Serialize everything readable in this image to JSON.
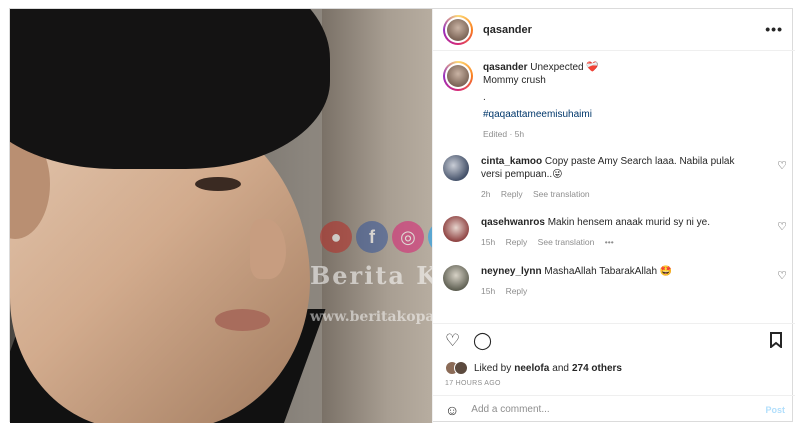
{
  "post": {
    "username": "qasander",
    "more_label": "•••"
  },
  "watermark": {
    "brand": "Berita Kopak",
    "url": "www.beritakopak.com"
  },
  "caption": {
    "username": "qasander",
    "text": "Unexpected",
    "emoji": "❤️‍🩹",
    "line2": "Mommy crush",
    "line3": ".",
    "hashtag": "#qaqaattameemisuhaimi",
    "edited": "Edited · 5h"
  },
  "comments": [
    {
      "username": "cinta_kamoo",
      "text": "Copy paste Amy Search laaa. Nabila pulak versi pempuan..😜",
      "time": "2h",
      "reply": "Reply",
      "translate": "See translation",
      "more": ""
    },
    {
      "username": "qasehwanros",
      "text": "Makin hensem anaak murid sy ni ye.",
      "time": "15h",
      "reply": "Reply",
      "translate": "See translation",
      "more": "•••"
    },
    {
      "username": "neyney_lynn",
      "text": "MashaAllah TabarakAllah 🤩",
      "time": "15h",
      "reply": "Reply",
      "translate": "",
      "more": ""
    }
  ],
  "likes": {
    "prefix": "Liked by",
    "user": "neelofa",
    "and": "and",
    "others": "274 others"
  },
  "time_ago": "17 HOURS AGO",
  "add_comment": {
    "placeholder": "Add a comment...",
    "post_label": "Post"
  },
  "icons": {
    "like": "heart-icon",
    "comment": "comment-icon",
    "save": "bookmark-icon",
    "emoji": "emoji-icon"
  },
  "colors": {
    "link": "#00376b",
    "muted": "#8e8e8e",
    "post_button": "#b2dffc"
  }
}
